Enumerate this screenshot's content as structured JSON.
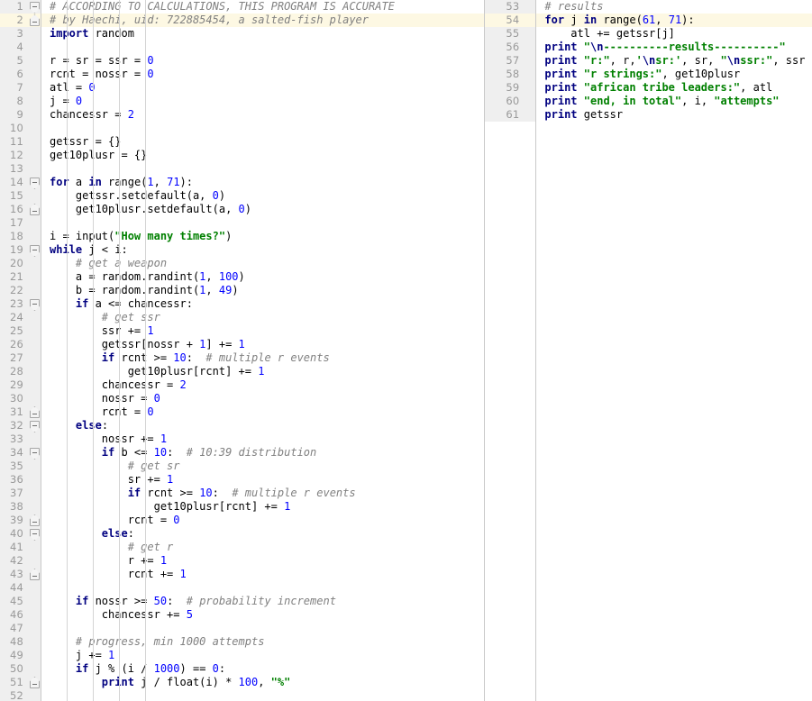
{
  "app": {
    "kind": "code-editor",
    "language": "Python 2",
    "theme": "light",
    "colors": {
      "background": "#ffffff",
      "gutter_background": "#efefef",
      "gutter_text": "#999999",
      "current_line": "#fdf8e3",
      "keyword": "#000080",
      "string": "#008000",
      "number": "#0000ff",
      "comment": "#808080",
      "plain": "#000000",
      "divider": "#c9c9c9",
      "indent_guide": "#d4d4d4"
    }
  },
  "left_pane": {
    "first_line": 1,
    "last_line": 52,
    "current_line": 2,
    "lines": [
      {
        "num": 1,
        "fold": "open",
        "tokens": [
          {
            "t": "# ACCORDING TO CALCULATIONS, THIS PROGRAM IS ACCURATE",
            "c": "c"
          }
        ]
      },
      {
        "num": 2,
        "fold": "close",
        "tokens": [
          {
            "t": "# by Haechi, uid: 722885454, a salted-fish player",
            "c": "c"
          }
        ]
      },
      {
        "num": 3,
        "fold": "",
        "tokens": [
          {
            "t": "import",
            "c": "k"
          },
          {
            "t": " random",
            "c": "p"
          }
        ]
      },
      {
        "num": 4,
        "fold": "",
        "tokens": []
      },
      {
        "num": 5,
        "fold": "",
        "tokens": [
          {
            "t": "r = sr = ssr = ",
            "c": "p"
          },
          {
            "t": "0",
            "c": "n"
          }
        ]
      },
      {
        "num": 6,
        "fold": "",
        "tokens": [
          {
            "t": "rcnt = nossr = ",
            "c": "p"
          },
          {
            "t": "0",
            "c": "n"
          }
        ]
      },
      {
        "num": 7,
        "fold": "",
        "tokens": [
          {
            "t": "atl = ",
            "c": "p"
          },
          {
            "t": "0",
            "c": "n"
          }
        ]
      },
      {
        "num": 8,
        "fold": "",
        "tokens": [
          {
            "t": "j = ",
            "c": "p"
          },
          {
            "t": "0",
            "c": "n"
          }
        ]
      },
      {
        "num": 9,
        "fold": "",
        "tokens": [
          {
            "t": "chancessr = ",
            "c": "p"
          },
          {
            "t": "2",
            "c": "n"
          }
        ]
      },
      {
        "num": 10,
        "fold": "",
        "tokens": []
      },
      {
        "num": 11,
        "fold": "",
        "tokens": [
          {
            "t": "getssr = {}",
            "c": "p"
          }
        ]
      },
      {
        "num": 12,
        "fold": "",
        "tokens": [
          {
            "t": "get10plusr = {}",
            "c": "p"
          }
        ]
      },
      {
        "num": 13,
        "fold": "",
        "tokens": []
      },
      {
        "num": 14,
        "fold": "open",
        "tokens": [
          {
            "t": "for",
            "c": "k"
          },
          {
            "t": " a ",
            "c": "p"
          },
          {
            "t": "in",
            "c": "k"
          },
          {
            "t": " range(",
            "c": "p"
          },
          {
            "t": "1",
            "c": "n"
          },
          {
            "t": ", ",
            "c": "p"
          },
          {
            "t": "71",
            "c": "n"
          },
          {
            "t": "):",
            "c": "p"
          }
        ]
      },
      {
        "num": 15,
        "fold": "",
        "tokens": [
          {
            "t": "    getssr.setdefault(a, ",
            "c": "p"
          },
          {
            "t": "0",
            "c": "n"
          },
          {
            "t": ")",
            "c": "p"
          }
        ]
      },
      {
        "num": 16,
        "fold": "close",
        "tokens": [
          {
            "t": "    get10plusr.setdefault(a, ",
            "c": "p"
          },
          {
            "t": "0",
            "c": "n"
          },
          {
            "t": ")",
            "c": "p"
          }
        ]
      },
      {
        "num": 17,
        "fold": "",
        "tokens": []
      },
      {
        "num": 18,
        "fold": "",
        "tokens": [
          {
            "t": "i = input(",
            "c": "p"
          },
          {
            "t": "\"How many times?\"",
            "c": "s"
          },
          {
            "t": ")",
            "c": "p"
          }
        ]
      },
      {
        "num": 19,
        "fold": "open",
        "tokens": [
          {
            "t": "while",
            "c": "k"
          },
          {
            "t": " j < i:",
            "c": "p"
          }
        ]
      },
      {
        "num": 20,
        "fold": "",
        "tokens": [
          {
            "t": "    ",
            "c": "p"
          },
          {
            "t": "# get a weapon",
            "c": "c"
          }
        ]
      },
      {
        "num": 21,
        "fold": "",
        "tokens": [
          {
            "t": "    a = random.randint(",
            "c": "p"
          },
          {
            "t": "1",
            "c": "n"
          },
          {
            "t": ", ",
            "c": "p"
          },
          {
            "t": "100",
            "c": "n"
          },
          {
            "t": ")",
            "c": "p"
          }
        ]
      },
      {
        "num": 22,
        "fold": "",
        "tokens": [
          {
            "t": "    b = random.randint(",
            "c": "p"
          },
          {
            "t": "1",
            "c": "n"
          },
          {
            "t": ", ",
            "c": "p"
          },
          {
            "t": "49",
            "c": "n"
          },
          {
            "t": ")",
            "c": "p"
          }
        ]
      },
      {
        "num": 23,
        "fold": "open",
        "tokens": [
          {
            "t": "    ",
            "c": "p"
          },
          {
            "t": "if",
            "c": "k"
          },
          {
            "t": " a <= chancessr:",
            "c": "p"
          }
        ]
      },
      {
        "num": 24,
        "fold": "",
        "tokens": [
          {
            "t": "        ",
            "c": "p"
          },
          {
            "t": "# get ssr",
            "c": "c"
          }
        ]
      },
      {
        "num": 25,
        "fold": "",
        "tokens": [
          {
            "t": "        ssr += ",
            "c": "p"
          },
          {
            "t": "1",
            "c": "n"
          }
        ]
      },
      {
        "num": 26,
        "fold": "",
        "tokens": [
          {
            "t": "        getssr[nossr + ",
            "c": "p"
          },
          {
            "t": "1",
            "c": "n"
          },
          {
            "t": "] += ",
            "c": "p"
          },
          {
            "t": "1",
            "c": "n"
          }
        ]
      },
      {
        "num": 27,
        "fold": "",
        "tokens": [
          {
            "t": "        ",
            "c": "p"
          },
          {
            "t": "if",
            "c": "k"
          },
          {
            "t": " rcnt >= ",
            "c": "p"
          },
          {
            "t": "10",
            "c": "n"
          },
          {
            "t": ":  ",
            "c": "p"
          },
          {
            "t": "# multiple r events",
            "c": "c"
          }
        ]
      },
      {
        "num": 28,
        "fold": "",
        "tokens": [
          {
            "t": "            get10plusr[rcnt] += ",
            "c": "p"
          },
          {
            "t": "1",
            "c": "n"
          }
        ]
      },
      {
        "num": 29,
        "fold": "",
        "tokens": [
          {
            "t": "        chancessr = ",
            "c": "p"
          },
          {
            "t": "2",
            "c": "n"
          }
        ]
      },
      {
        "num": 30,
        "fold": "",
        "tokens": [
          {
            "t": "        nossr = ",
            "c": "p"
          },
          {
            "t": "0",
            "c": "n"
          }
        ]
      },
      {
        "num": 31,
        "fold": "close",
        "tokens": [
          {
            "t": "        rcnt = ",
            "c": "p"
          },
          {
            "t": "0",
            "c": "n"
          }
        ]
      },
      {
        "num": 32,
        "fold": "open",
        "tokens": [
          {
            "t": "    ",
            "c": "p"
          },
          {
            "t": "else",
            "c": "k"
          },
          {
            "t": ":",
            "c": "p"
          }
        ]
      },
      {
        "num": 33,
        "fold": "",
        "tokens": [
          {
            "t": "        nossr += ",
            "c": "p"
          },
          {
            "t": "1",
            "c": "n"
          }
        ]
      },
      {
        "num": 34,
        "fold": "open",
        "tokens": [
          {
            "t": "        ",
            "c": "p"
          },
          {
            "t": "if",
            "c": "k"
          },
          {
            "t": " b <= ",
            "c": "p"
          },
          {
            "t": "10",
            "c": "n"
          },
          {
            "t": ":  ",
            "c": "p"
          },
          {
            "t": "# 10:39 distribution",
            "c": "c"
          }
        ]
      },
      {
        "num": 35,
        "fold": "",
        "tokens": [
          {
            "t": "            ",
            "c": "p"
          },
          {
            "t": "# get sr",
            "c": "c"
          }
        ]
      },
      {
        "num": 36,
        "fold": "",
        "tokens": [
          {
            "t": "            sr += ",
            "c": "p"
          },
          {
            "t": "1",
            "c": "n"
          }
        ]
      },
      {
        "num": 37,
        "fold": "",
        "tokens": [
          {
            "t": "            ",
            "c": "p"
          },
          {
            "t": "if",
            "c": "k"
          },
          {
            "t": " rcnt >= ",
            "c": "p"
          },
          {
            "t": "10",
            "c": "n"
          },
          {
            "t": ":  ",
            "c": "p"
          },
          {
            "t": "# multiple r events",
            "c": "c"
          }
        ]
      },
      {
        "num": 38,
        "fold": "",
        "tokens": [
          {
            "t": "                get10plusr[rcnt] += ",
            "c": "p"
          },
          {
            "t": "1",
            "c": "n"
          }
        ]
      },
      {
        "num": 39,
        "fold": "close",
        "tokens": [
          {
            "t": "            rcnt = ",
            "c": "p"
          },
          {
            "t": "0",
            "c": "n"
          }
        ]
      },
      {
        "num": 40,
        "fold": "open",
        "tokens": [
          {
            "t": "        ",
            "c": "p"
          },
          {
            "t": "else",
            "c": "k"
          },
          {
            "t": ":",
            "c": "p"
          }
        ]
      },
      {
        "num": 41,
        "fold": "",
        "tokens": [
          {
            "t": "            ",
            "c": "p"
          },
          {
            "t": "# get r",
            "c": "c"
          }
        ]
      },
      {
        "num": 42,
        "fold": "",
        "tokens": [
          {
            "t": "            r += ",
            "c": "p"
          },
          {
            "t": "1",
            "c": "n"
          }
        ]
      },
      {
        "num": 43,
        "fold": "close",
        "tokens": [
          {
            "t": "            rcnt += ",
            "c": "p"
          },
          {
            "t": "1",
            "c": "n"
          }
        ]
      },
      {
        "num": 44,
        "fold": "",
        "tokens": []
      },
      {
        "num": 45,
        "fold": "",
        "tokens": [
          {
            "t": "    ",
            "c": "p"
          },
          {
            "t": "if",
            "c": "k"
          },
          {
            "t": " nossr >= ",
            "c": "p"
          },
          {
            "t": "50",
            "c": "n"
          },
          {
            "t": ":  ",
            "c": "p"
          },
          {
            "t": "# probability increment",
            "c": "c"
          }
        ]
      },
      {
        "num": 46,
        "fold": "",
        "tokens": [
          {
            "t": "        chancessr += ",
            "c": "p"
          },
          {
            "t": "5",
            "c": "n"
          }
        ]
      },
      {
        "num": 47,
        "fold": "",
        "tokens": []
      },
      {
        "num": 48,
        "fold": "",
        "tokens": [
          {
            "t": "    ",
            "c": "p"
          },
          {
            "t": "# progress, min 1000 attempts",
            "c": "c"
          }
        ]
      },
      {
        "num": 49,
        "fold": "",
        "tokens": [
          {
            "t": "    j += ",
            "c": "p"
          },
          {
            "t": "1",
            "c": "n"
          }
        ]
      },
      {
        "num": 50,
        "fold": "",
        "tokens": [
          {
            "t": "    ",
            "c": "p"
          },
          {
            "t": "if",
            "c": "k"
          },
          {
            "t": " j % (i / ",
            "c": "p"
          },
          {
            "t": "1000",
            "c": "n"
          },
          {
            "t": ") == ",
            "c": "p"
          },
          {
            "t": "0",
            "c": "n"
          },
          {
            "t": ":",
            "c": "p"
          }
        ]
      },
      {
        "num": 51,
        "fold": "close",
        "tokens": [
          {
            "t": "        ",
            "c": "p"
          },
          {
            "t": "print",
            "c": "k"
          },
          {
            "t": " j / float(i) * ",
            "c": "p"
          },
          {
            "t": "100",
            "c": "n"
          },
          {
            "t": ", ",
            "c": "p"
          },
          {
            "t": "\"%\"",
            "c": "s"
          }
        ]
      },
      {
        "num": 52,
        "fold": "",
        "tokens": []
      }
    ]
  },
  "right_pane": {
    "first_line": 53,
    "last_line": 61,
    "current_line": 54,
    "lines": [
      {
        "num": 53,
        "fold": "",
        "tokens": [
          {
            "t": "# results",
            "c": "c"
          }
        ]
      },
      {
        "num": 54,
        "fold": "",
        "tokens": [
          {
            "t": "for",
            "c": "k"
          },
          {
            "t": " j ",
            "c": "p"
          },
          {
            "t": "in",
            "c": "k"
          },
          {
            "t": " range(",
            "c": "p"
          },
          {
            "t": "61",
            "c": "n"
          },
          {
            "t": ", ",
            "c": "p"
          },
          {
            "t": "71",
            "c": "n"
          },
          {
            "t": "):",
            "c": "p"
          }
        ]
      },
      {
        "num": 55,
        "fold": "",
        "tokens": [
          {
            "t": "    atl += getssr[j]",
            "c": "p"
          }
        ]
      },
      {
        "num": 56,
        "fold": "",
        "tokens": [
          {
            "t": "print",
            "c": "k"
          },
          {
            "t": " ",
            "c": "p"
          },
          {
            "t": "\"",
            "c": "s"
          },
          {
            "t": "\\n",
            "c": "esc"
          },
          {
            "t": "----------results----------\"",
            "c": "s"
          }
        ]
      },
      {
        "num": 57,
        "fold": "",
        "tokens": [
          {
            "t": "print",
            "c": "k"
          },
          {
            "t": " ",
            "c": "p"
          },
          {
            "t": "\"r:\"",
            "c": "s"
          },
          {
            "t": ", r,",
            "c": "p"
          },
          {
            "t": "'",
            "c": "s"
          },
          {
            "t": "\\n",
            "c": "esc"
          },
          {
            "t": "sr:'",
            "c": "s"
          },
          {
            "t": ", sr, ",
            "c": "p"
          },
          {
            "t": "\"",
            "c": "s"
          },
          {
            "t": "\\n",
            "c": "esc"
          },
          {
            "t": "ssr:\"",
            "c": "s"
          },
          {
            "t": ", ssr",
            "c": "p"
          }
        ]
      },
      {
        "num": 58,
        "fold": "",
        "tokens": [
          {
            "t": "print",
            "c": "k"
          },
          {
            "t": " ",
            "c": "p"
          },
          {
            "t": "\"r strings:\"",
            "c": "s"
          },
          {
            "t": ", get10plusr",
            "c": "p"
          }
        ]
      },
      {
        "num": 59,
        "fold": "",
        "tokens": [
          {
            "t": "print",
            "c": "k"
          },
          {
            "t": " ",
            "c": "p"
          },
          {
            "t": "\"african tribe leaders:\"",
            "c": "s"
          },
          {
            "t": ", atl",
            "c": "p"
          }
        ]
      },
      {
        "num": 60,
        "fold": "",
        "tokens": [
          {
            "t": "print",
            "c": "k"
          },
          {
            "t": " ",
            "c": "p"
          },
          {
            "t": "\"end, in total\"",
            "c": "s"
          },
          {
            "t": ", i, ",
            "c": "p"
          },
          {
            "t": "\"attempts\"",
            "c": "s"
          }
        ]
      },
      {
        "num": 61,
        "fold": "",
        "tokens": [
          {
            "t": "print",
            "c": "k"
          },
          {
            "t": " getssr",
            "c": "p"
          }
        ]
      }
    ]
  }
}
